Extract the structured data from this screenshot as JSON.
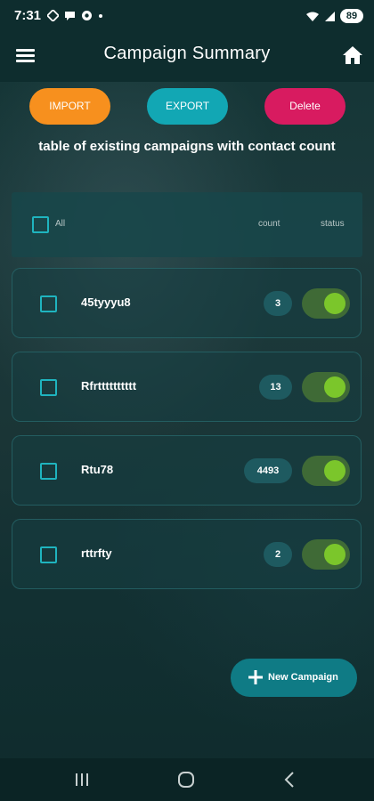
{
  "status_bar": {
    "time": "7:31",
    "battery": "89",
    "left_icons": [
      "diamond-icon",
      "chat-bubble-icon",
      "camera-icon",
      "dot-icon"
    ],
    "right_icons": [
      "wifi-icon",
      "signal-icon"
    ]
  },
  "app_bar": {
    "title": "Campaign Summary",
    "menu_icon": "hamburger-menu-icon",
    "home_icon": "home-icon"
  },
  "actions": {
    "import_label": "IMPORT",
    "export_label": "EXPORT",
    "delete_label": "Delete"
  },
  "caption": "table of existing campaigns with contact count",
  "table": {
    "header": {
      "all_label": "All",
      "count_label": "count",
      "status_label": "status"
    },
    "rows": [
      {
        "name": "45tyyyu8",
        "count": "3",
        "status_on": true
      },
      {
        "name": "Rfrtttttttttt",
        "count": "13",
        "status_on": true
      },
      {
        "name": "Rtu78",
        "count": "4493",
        "status_on": true
      },
      {
        "name": "rttrfty",
        "count": "2",
        "status_on": true
      }
    ]
  },
  "fab": {
    "label": "New Campaign"
  },
  "colors": {
    "import": "#f7901e",
    "export": "#12a7b4",
    "delete": "#d81b60",
    "toggle_on": "#7bc62b",
    "checkbox": "#1fb4bf",
    "fab": "#0f7b85"
  }
}
